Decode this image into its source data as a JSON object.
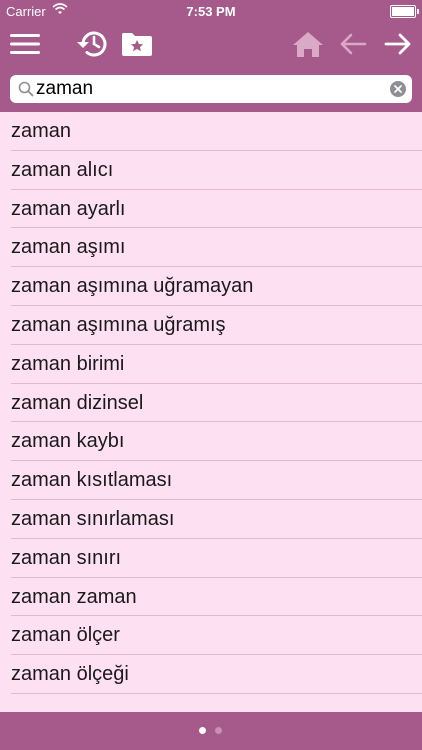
{
  "status": {
    "carrier": "Carrier",
    "time": "7:53 PM"
  },
  "search": {
    "value": "zaman"
  },
  "results": [
    "zaman",
    "zaman alıcı",
    "zaman ayarlı",
    "zaman aşımı",
    "zaman aşımına uğramayan",
    "zaman aşımına uğramış",
    "zaman birimi",
    "zaman dizinsel",
    "zaman kaybı",
    "zaman kısıtlaması",
    "zaman sınırlaması",
    "zaman sınırı",
    "zaman zaman",
    "zaman ölçer",
    "zaman ölçeği"
  ],
  "pager": {
    "count": 2,
    "active": 0
  },
  "colors": {
    "bar": "#a55a8b",
    "list_bg": "#fde0f2",
    "separator": "#e6b7d3",
    "disabled_icon": "#d9a9c6"
  },
  "icons": [
    "menu-icon",
    "history-icon",
    "favorites-folder-icon",
    "home-icon",
    "back-arrow-icon",
    "forward-arrow-icon",
    "search-icon",
    "clear-icon"
  ]
}
